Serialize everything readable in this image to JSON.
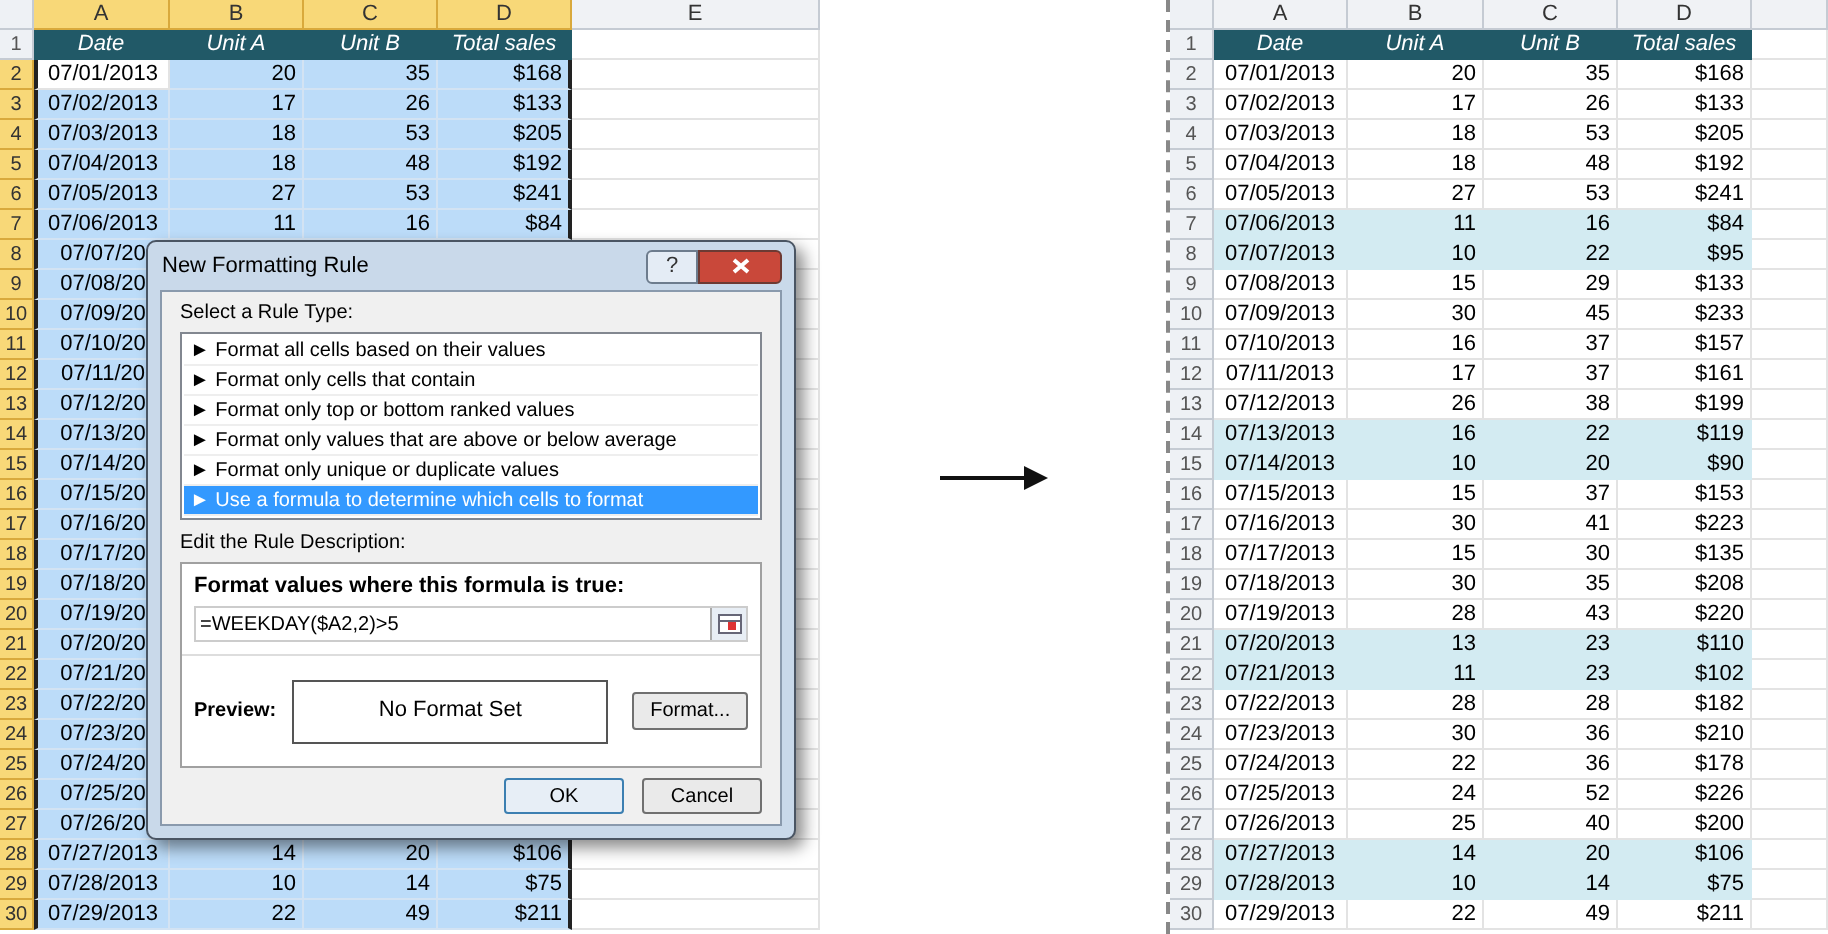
{
  "left_sheet": {
    "columns": [
      {
        "label": "A",
        "selected": true
      },
      {
        "label": "B",
        "selected": true
      },
      {
        "label": "C",
        "selected": true
      },
      {
        "label": "D",
        "selected": true
      },
      {
        "label": "E",
        "selected": false
      }
    ],
    "header": {
      "number": "1",
      "cells": [
        "Date",
        "Unit A",
        "Unit B",
        "Total sales"
      ]
    },
    "rows": [
      {
        "number": "2",
        "selected": true,
        "active": true,
        "cells": [
          "07/01/2013",
          "20",
          "35",
          "$168"
        ]
      },
      {
        "number": "3",
        "selected": true,
        "active": false,
        "cells": [
          "07/02/2013",
          "17",
          "26",
          "$133"
        ]
      },
      {
        "number": "4",
        "selected": true,
        "active": false,
        "cells": [
          "07/03/2013",
          "18",
          "53",
          "$205"
        ]
      },
      {
        "number": "5",
        "selected": true,
        "active": false,
        "cells": [
          "07/04/2013",
          "18",
          "48",
          "$192"
        ]
      },
      {
        "number": "6",
        "selected": true,
        "active": false,
        "cells": [
          "07/05/2013",
          "27",
          "53",
          "$241"
        ]
      },
      {
        "number": "7",
        "selected": true,
        "active": false,
        "cells": [
          "07/06/2013",
          "11",
          "16",
          "$84"
        ]
      },
      {
        "number": "8",
        "selected": true,
        "active": false,
        "cells": [
          "07/07/20"
        ]
      },
      {
        "number": "9",
        "selected": true,
        "active": false,
        "cells": [
          "07/08/20"
        ]
      },
      {
        "number": "10",
        "selected": true,
        "active": false,
        "cells": [
          "07/09/20"
        ]
      },
      {
        "number": "11",
        "selected": true,
        "active": false,
        "cells": [
          "07/10/20"
        ]
      },
      {
        "number": "12",
        "selected": true,
        "active": false,
        "cells": [
          "07/11/20"
        ]
      },
      {
        "number": "13",
        "selected": true,
        "active": false,
        "cells": [
          "07/12/20"
        ]
      },
      {
        "number": "14",
        "selected": true,
        "active": false,
        "cells": [
          "07/13/20"
        ]
      },
      {
        "number": "15",
        "selected": true,
        "active": false,
        "cells": [
          "07/14/20"
        ]
      },
      {
        "number": "16",
        "selected": true,
        "active": false,
        "cells": [
          "07/15/20"
        ]
      },
      {
        "number": "17",
        "selected": true,
        "active": false,
        "cells": [
          "07/16/20"
        ]
      },
      {
        "number": "18",
        "selected": true,
        "active": false,
        "cells": [
          "07/17/20"
        ]
      },
      {
        "number": "19",
        "selected": true,
        "active": false,
        "cells": [
          "07/18/20"
        ]
      },
      {
        "number": "20",
        "selected": true,
        "active": false,
        "cells": [
          "07/19/20"
        ]
      },
      {
        "number": "21",
        "selected": true,
        "active": false,
        "cells": [
          "07/20/20"
        ]
      },
      {
        "number": "22",
        "selected": true,
        "active": false,
        "cells": [
          "07/21/20"
        ]
      },
      {
        "number": "23",
        "selected": true,
        "active": false,
        "cells": [
          "07/22/20"
        ]
      },
      {
        "number": "24",
        "selected": true,
        "active": false,
        "cells": [
          "07/23/20"
        ]
      },
      {
        "number": "25",
        "selected": true,
        "active": false,
        "cells": [
          "07/24/20"
        ]
      },
      {
        "number": "26",
        "selected": true,
        "active": false,
        "cells": [
          "07/25/20"
        ]
      },
      {
        "number": "27",
        "selected": true,
        "active": false,
        "cells": [
          "07/26/20"
        ]
      },
      {
        "number": "28",
        "selected": true,
        "active": false,
        "cells": [
          "07/27/2013",
          "14",
          "20",
          "$106"
        ]
      },
      {
        "number": "29",
        "selected": true,
        "active": false,
        "cells": [
          "07/28/2013",
          "10",
          "14",
          "$75"
        ]
      },
      {
        "number": "30",
        "selected": true,
        "active": false,
        "cells": [
          "07/29/2013",
          "22",
          "49",
          "$211"
        ]
      }
    ]
  },
  "dialog": {
    "title": "New Formatting Rule",
    "help_button": "?",
    "rule_type_label": "Select a Rule Type:",
    "rule_types": [
      {
        "label": "► Format all cells based on their values",
        "selected": false
      },
      {
        "label": "► Format only cells that contain",
        "selected": false
      },
      {
        "label": "► Format only top or bottom ranked values",
        "selected": false
      },
      {
        "label": "► Format only values that are above or below average",
        "selected": false
      },
      {
        "label": "► Format only unique or duplicate values",
        "selected": false
      },
      {
        "label": "► Use a formula to determine which cells to format",
        "selected": true
      }
    ],
    "description_label": "Edit the Rule Description:",
    "formula_label": "Format values where this formula is true:",
    "formula": "=WEEKDAY($A2,2)>5",
    "preview_label": "Preview:",
    "preview_text": "No Format Set",
    "format_button": "Format...",
    "ok_button": "OK",
    "cancel_button": "Cancel"
  },
  "right_sheet": {
    "columns": [
      "A",
      "B",
      "C",
      "D"
    ],
    "header": {
      "number": "1",
      "cells": [
        "Date",
        "Unit A",
        "Unit B",
        "Total sales"
      ]
    },
    "rows": [
      {
        "number": "2",
        "highlighted": false,
        "cells": [
          "07/01/2013",
          "20",
          "35",
          "$168"
        ]
      },
      {
        "number": "3",
        "highlighted": false,
        "cells": [
          "07/02/2013",
          "17",
          "26",
          "$133"
        ]
      },
      {
        "number": "4",
        "highlighted": false,
        "cells": [
          "07/03/2013",
          "18",
          "53",
          "$205"
        ]
      },
      {
        "number": "5",
        "highlighted": false,
        "cells": [
          "07/04/2013",
          "18",
          "48",
          "$192"
        ]
      },
      {
        "number": "6",
        "highlighted": false,
        "cells": [
          "07/05/2013",
          "27",
          "53",
          "$241"
        ]
      },
      {
        "number": "7",
        "highlighted": true,
        "cells": [
          "07/06/2013",
          "11",
          "16",
          "$84"
        ]
      },
      {
        "number": "8",
        "highlighted": true,
        "cells": [
          "07/07/2013",
          "10",
          "22",
          "$95"
        ]
      },
      {
        "number": "9",
        "highlighted": false,
        "cells": [
          "07/08/2013",
          "15",
          "29",
          "$133"
        ]
      },
      {
        "number": "10",
        "highlighted": false,
        "cells": [
          "07/09/2013",
          "30",
          "45",
          "$233"
        ]
      },
      {
        "number": "11",
        "highlighted": false,
        "cells": [
          "07/10/2013",
          "16",
          "37",
          "$157"
        ]
      },
      {
        "number": "12",
        "highlighted": false,
        "cells": [
          "07/11/2013",
          "17",
          "37",
          "$161"
        ]
      },
      {
        "number": "13",
        "highlighted": false,
        "cells": [
          "07/12/2013",
          "26",
          "38",
          "$199"
        ]
      },
      {
        "number": "14",
        "highlighted": true,
        "cells": [
          "07/13/2013",
          "16",
          "22",
          "$119"
        ]
      },
      {
        "number": "15",
        "highlighted": true,
        "cells": [
          "07/14/2013",
          "10",
          "20",
          "$90"
        ]
      },
      {
        "number": "16",
        "highlighted": false,
        "cells": [
          "07/15/2013",
          "15",
          "37",
          "$153"
        ]
      },
      {
        "number": "17",
        "highlighted": false,
        "cells": [
          "07/16/2013",
          "30",
          "41",
          "$223"
        ]
      },
      {
        "number": "18",
        "highlighted": false,
        "cells": [
          "07/17/2013",
          "15",
          "30",
          "$135"
        ]
      },
      {
        "number": "19",
        "highlighted": false,
        "cells": [
          "07/18/2013",
          "30",
          "35",
          "$208"
        ]
      },
      {
        "number": "20",
        "highlighted": false,
        "cells": [
          "07/19/2013",
          "28",
          "43",
          "$220"
        ]
      },
      {
        "number": "21",
        "highlighted": true,
        "cells": [
          "07/20/2013",
          "13",
          "23",
          "$110"
        ]
      },
      {
        "number": "22",
        "highlighted": true,
        "cells": [
          "07/21/2013",
          "11",
          "23",
          "$102"
        ]
      },
      {
        "number": "23",
        "highlighted": false,
        "cells": [
          "07/22/2013",
          "28",
          "28",
          "$182"
        ]
      },
      {
        "number": "24",
        "highlighted": false,
        "cells": [
          "07/23/2013",
          "30",
          "36",
          "$210"
        ]
      },
      {
        "number": "25",
        "highlighted": false,
        "cells": [
          "07/24/2013",
          "22",
          "36",
          "$178"
        ]
      },
      {
        "number": "26",
        "highlighted": false,
        "cells": [
          "07/25/2013",
          "24",
          "52",
          "$226"
        ]
      },
      {
        "number": "27",
        "highlighted": false,
        "cells": [
          "07/26/2013",
          "25",
          "40",
          "$200"
        ]
      },
      {
        "number": "28",
        "highlighted": true,
        "cells": [
          "07/27/2013",
          "14",
          "20",
          "$106"
        ]
      },
      {
        "number": "29",
        "highlighted": true,
        "cells": [
          "07/28/2013",
          "10",
          "14",
          "$75"
        ]
      },
      {
        "number": "30",
        "highlighted": false,
        "cells": [
          "07/29/2013",
          "22",
          "49",
          "$211"
        ]
      }
    ]
  }
}
